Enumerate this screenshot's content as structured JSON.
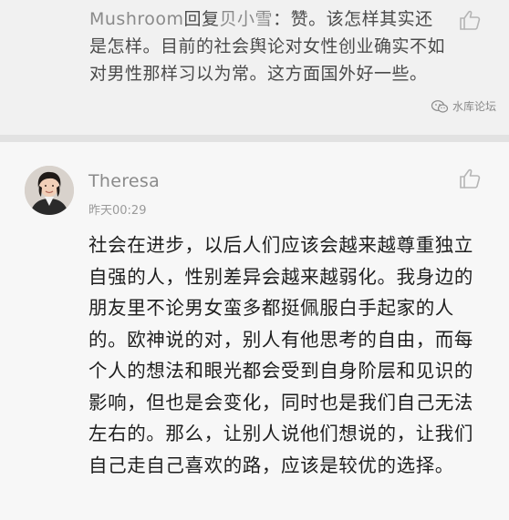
{
  "reply": {
    "author": "Mushroom",
    "verb": "回复",
    "target": "贝小雪",
    "separator": "：",
    "text": "赞。该怎样其实还是怎样。目前的社会舆论对女性创业确实不如对男性那样习以为常。这方面国外好一些。"
  },
  "watermark": {
    "label": "水库论坛",
    "icon": "wechat-icon"
  },
  "comment": {
    "username": "Theresa",
    "timestamp": "昨天00:29",
    "text": "社会在进步，以后人们应该会越来越尊重独立自强的人，性别差异会越来越弱化。我身边的朋友里不论男女蛮多都挺佩服白手起家的人的。欧神说的对，别人有他思考的自由，而每个人的想法和眼光都会受到自身阶层和见识的影响，但也是会变化，同时也是我们自己无法左右的。那么，让别人说他们想说的，让我们自己走自己喜欢的路，应该是较优的选择。"
  },
  "icons": {
    "like": "thumbs-up-icon",
    "avatar": "avatar"
  },
  "colors": {
    "reply_bg": "#f1f1f1",
    "comment_bg": "#f7f7f7",
    "meta_text": "#8a8a8a",
    "body_text": "#1e1e1e"
  }
}
